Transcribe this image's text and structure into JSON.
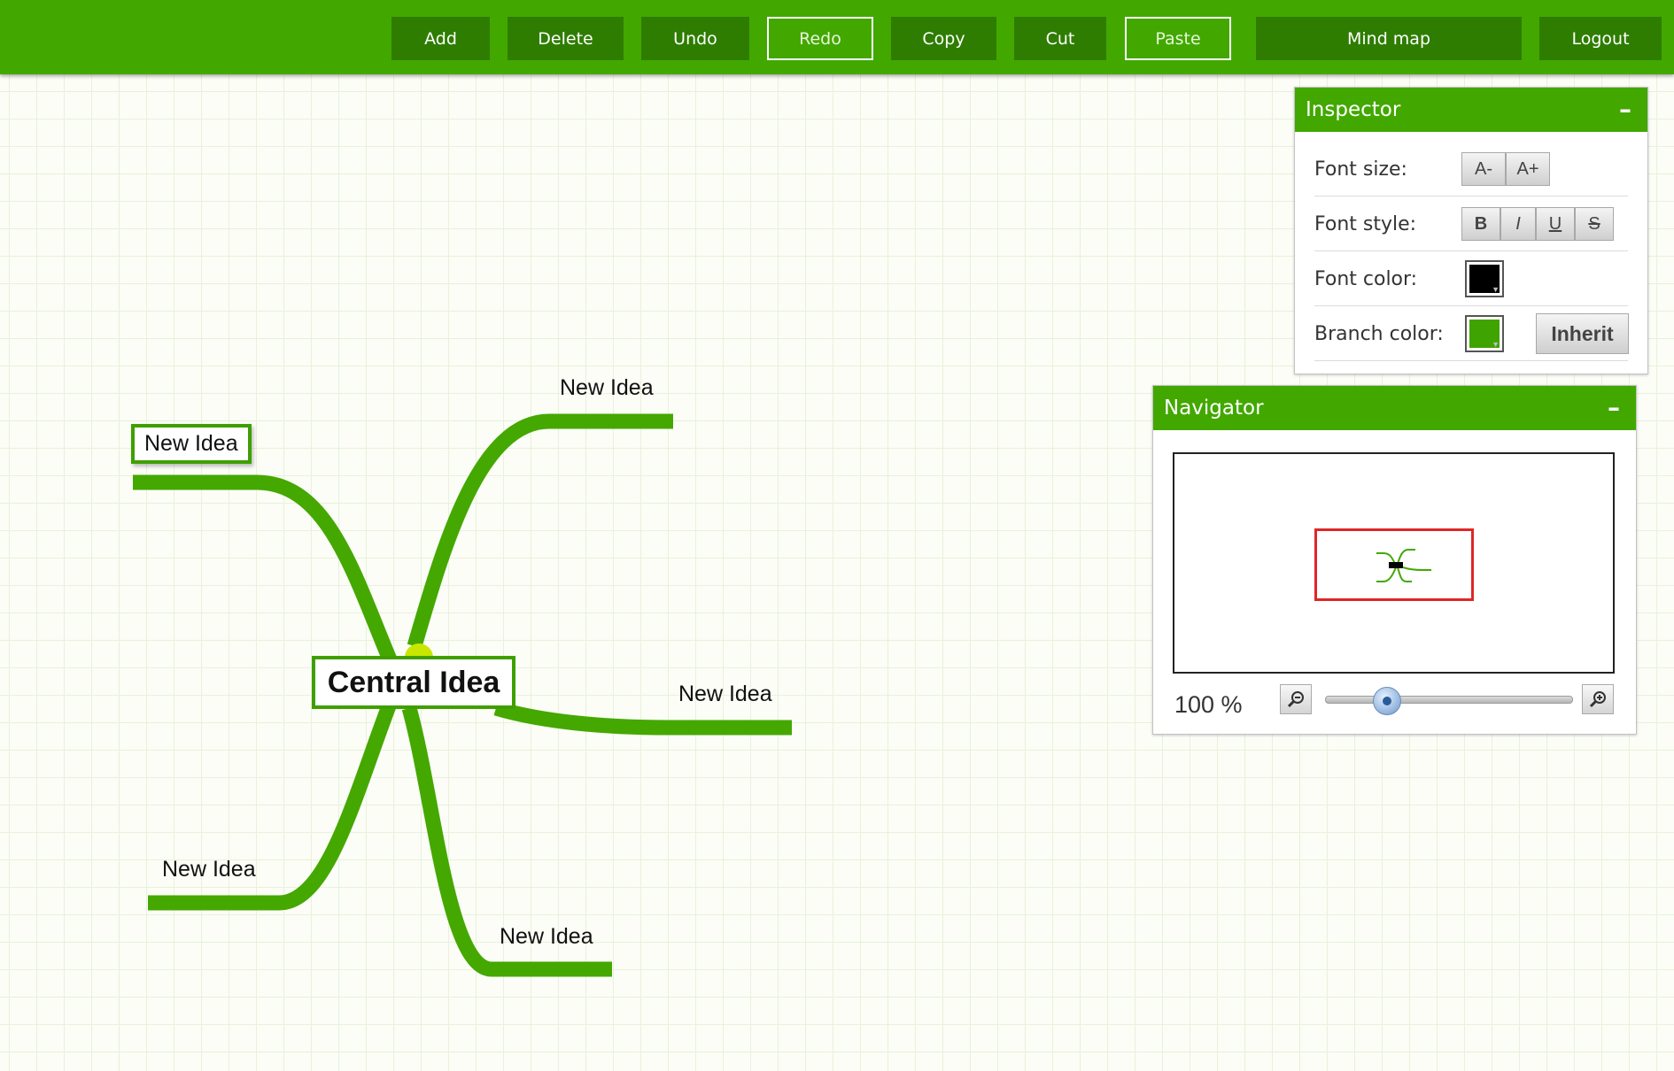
{
  "toolbar": {
    "buttons": [
      {
        "label": "Add",
        "enabled": true
      },
      {
        "label": "Delete",
        "enabled": true
      },
      {
        "label": "Undo",
        "enabled": true
      },
      {
        "label": "Redo",
        "enabled": false
      },
      {
        "label": "Copy",
        "enabled": true
      },
      {
        "label": "Cut",
        "enabled": true
      },
      {
        "label": "Paste",
        "enabled": false
      },
      {
        "label": "Mind map",
        "enabled": true
      },
      {
        "label": "Logout",
        "enabled": true
      }
    ]
  },
  "mindmap": {
    "central": "Central Idea",
    "branch_color": "#44a800",
    "nodes": [
      {
        "label": "New Idea",
        "side": "left",
        "selected": true
      },
      {
        "label": "New Idea",
        "side": "right"
      },
      {
        "label": "New Idea",
        "side": "right"
      },
      {
        "label": "New Idea",
        "side": "left"
      },
      {
        "label": "New Idea",
        "side": "right"
      }
    ]
  },
  "inspector": {
    "title": "Inspector",
    "minimize": "–",
    "font_size": {
      "label": "Font size:",
      "decrease": "A-",
      "increase": "A+"
    },
    "font_style": {
      "label": "Font style:",
      "bold": "B",
      "italic": "I",
      "underline": "U",
      "strike": "S"
    },
    "font_color": {
      "label": "Font color:",
      "value": "#000000"
    },
    "branch_color": {
      "label": "Branch color:",
      "value": "#3fa300",
      "inherit": "Inherit"
    }
  },
  "navigator": {
    "title": "Navigator",
    "minimize": "–",
    "zoom": "100 %",
    "zoom_level": 0.25,
    "viewport_color": "#e02626"
  },
  "colors": {
    "toolbar_bg": "#42a800",
    "button_bg": "#2e7d00",
    "accent": "#3f9f00",
    "handle": "#c9e600"
  }
}
